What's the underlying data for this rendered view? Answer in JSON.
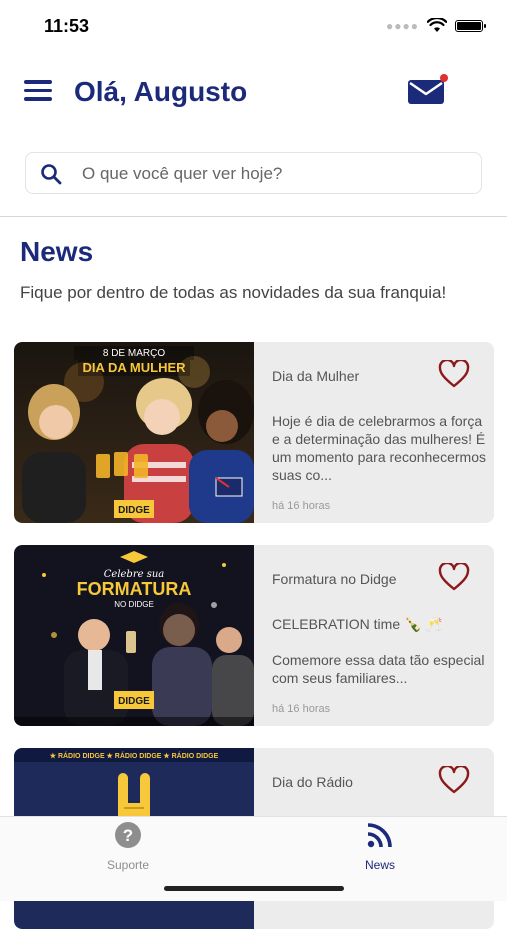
{
  "status_bar": {
    "time": "11:53"
  },
  "header": {
    "greeting": "Olá, Augusto"
  },
  "search": {
    "placeholder": "O que você quer ver hoje?"
  },
  "section": {
    "title": "News",
    "subtitle": "Fique por dentro de todas as novidades da sua franquia!"
  },
  "news": [
    {
      "title": "Dia da Mulher",
      "body": [
        "Hoje é dia de celebrarmos a força e a determinação das mulheres! É um momento para reconhecermos suas co..."
      ],
      "time": "há 16 horas",
      "image_texts": [
        "8 DE MARÇO",
        "DIA DA MULHER",
        "DIDGE"
      ]
    },
    {
      "title": "Formatura no Didge",
      "body": [
        "CELEBRATION time 🍾 🥂",
        "Comemore essa data tão especial com seus familiares..."
      ],
      "time": "há 16 horas",
      "image_texts": [
        "Celebre sua",
        "FORMATURA",
        "NO DIDGE",
        "DIDGE"
      ]
    },
    {
      "title": "Dia do Rádio",
      "body": [],
      "time": "",
      "image_texts": [
        "★ RÁDIO DIDGE ★ RÁDIO DIDGE ★ RÁDIO DIDGE"
      ]
    }
  ],
  "tabbar": {
    "items": [
      {
        "label": "Suporte",
        "icon": "question-circle-icon",
        "active": false
      },
      {
        "label": "News",
        "icon": "rss-feed-icon",
        "active": true
      }
    ]
  },
  "colors": {
    "brand_navy": "#1c2a7a",
    "heart_red": "#8b1a1a",
    "notification_red": "#e03030",
    "card_bg": "#ececec"
  }
}
